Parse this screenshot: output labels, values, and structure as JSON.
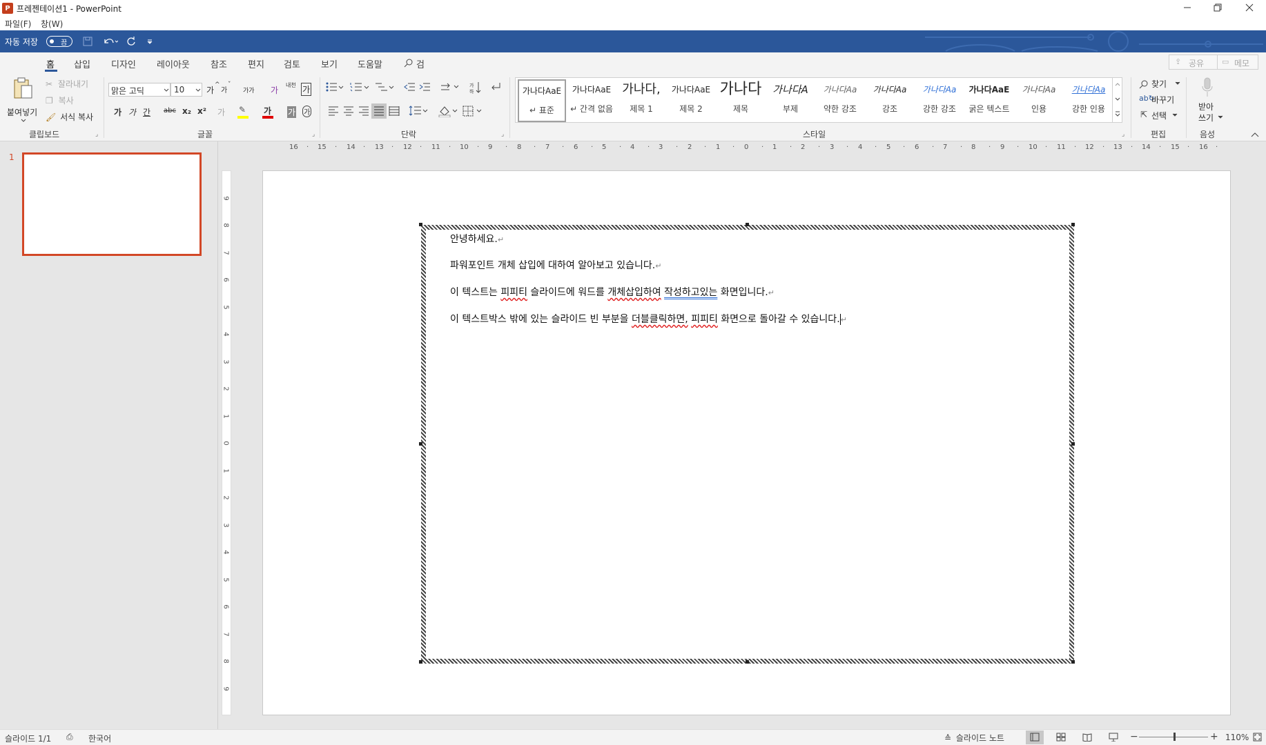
{
  "window": {
    "title": "프레젠테이션1 - PowerPoint",
    "app_icon": "P"
  },
  "menu": {
    "file": "파일(F)",
    "window": "창(W)"
  },
  "qat": {
    "autosave_label": "자동 저장",
    "autosave_state": "끔"
  },
  "tabs": [
    "홈",
    "삽입",
    "디자인",
    "레이아웃",
    "참조",
    "편지",
    "검토",
    "보기",
    "도움말"
  ],
  "search": {
    "label": "검색"
  },
  "share": {
    "share": "공유",
    "comments": "메모"
  },
  "clipboard": {
    "paste": "붙여넣기",
    "cut": "잘라내기",
    "copy": "복사",
    "format_painter": "서식 복사",
    "group": "클립보드"
  },
  "font": {
    "name": "맑은 고딕",
    "size": "10",
    "grow": "가",
    "shrink": "가",
    "case": "가가",
    "clear": "가",
    "phonetic": "내천",
    "char_border": "가",
    "bold": "가",
    "italic": "가",
    "underline": "간",
    "strike": "abc",
    "sub": "x₂",
    "sup": "x²",
    "highlight": "가",
    "color": "가",
    "shade": "가",
    "enclose": "가",
    "group": "글꼴"
  },
  "paragraph": {
    "group": "단락"
  },
  "styles": {
    "group": "스타일",
    "items": [
      {
        "preview": "가나다AaE",
        "name": "↵ 표준"
      },
      {
        "preview": "가나다AaE",
        "name": "↵ 간격 없음"
      },
      {
        "preview": "가나다,",
        "name": "제목 1"
      },
      {
        "preview": "가나다AaE",
        "name": "제목 2"
      },
      {
        "preview": "가나다",
        "name": "제목"
      },
      {
        "preview": "가나다A",
        "name": "부제"
      },
      {
        "preview": "가나다Aa",
        "name": "약한 강조"
      },
      {
        "preview": "가나다Aa",
        "name": "강조"
      },
      {
        "preview": "가나다Aa",
        "name": "강한 강조"
      },
      {
        "preview": "가나다AaE",
        "name": "굵은 텍스트"
      },
      {
        "preview": "가나다Aa",
        "name": "인용"
      },
      {
        "preview": "가나다Aa",
        "name": "강한 인용"
      }
    ]
  },
  "editing": {
    "find": "찾기",
    "replace": "바꾸기",
    "select": "선택",
    "group": "편집"
  },
  "voice": {
    "dictate_1": "받아",
    "dictate_2": "쓰기",
    "group": "음성"
  },
  "hruler_ticks": [
    "16",
    "15",
    "14",
    "13",
    "12",
    "11",
    "10",
    "9",
    "8",
    "7",
    "6",
    "5",
    "4",
    "3",
    "2",
    "1",
    "0",
    "1",
    "2",
    "3",
    "4",
    "5",
    "6",
    "7",
    "8",
    "9",
    "10",
    "11",
    "12",
    "13",
    "14",
    "15",
    "16"
  ],
  "vruler_ticks": [
    "9",
    "8",
    "7",
    "6",
    "5",
    "4",
    "3",
    "2",
    "1",
    "0",
    "1",
    "2",
    "3",
    "4",
    "5",
    "6",
    "7",
    "8",
    "9"
  ],
  "thumbnail": {
    "number": "1"
  },
  "document": {
    "lines": [
      {
        "text": "안녕하세요.",
        "mark": "↵"
      },
      {
        "text": "파워포인트 개체 삽입에 대하여 알아보고 있습니다.",
        "mark": "↵"
      },
      {
        "pre": "이 텍스트는 ",
        "w1": "피피티",
        "mid1": " 슬라이드에 워드를 ",
        "w2": "개체삽입하여",
        "mid2": " ",
        "w3": "작성하고있는",
        "post": " 화면입니다.",
        "mark": "↵"
      },
      {
        "pre": "이 텍스트박스 밖에 있는 슬라이드 빈 부분을 ",
        "w1": "더블클릭하면,",
        "mid1": " ",
        "w2": "피피티",
        "post": " 화면으로 돌아갈 수 있습니다.",
        "mark": "↵"
      }
    ]
  },
  "status": {
    "slide": "슬라이드 1/1",
    "language": "한국어",
    "notes": "슬라이드 노트",
    "zoom": "110%"
  },
  "colors": {
    "accent": "#2b579a",
    "thumb_border": "#d24726"
  }
}
